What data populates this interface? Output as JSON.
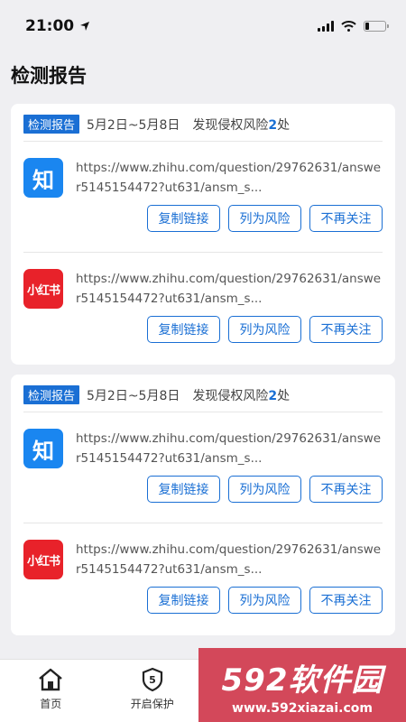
{
  "status_bar": {
    "time": "21:00"
  },
  "page": {
    "title": "检测报告"
  },
  "reports": [
    {
      "tag": "检测报告",
      "date_range": "5月2日~5月8日",
      "risk_prefix": "发现侵权风险",
      "risk_count": "2",
      "risk_suffix": "处",
      "items": [
        {
          "logo": "知",
          "logo_icon": "zhihu-logo-icon",
          "url": "https://www.zhihu.com/question/29762631/answer5145154472?ut631/ansm_s...",
          "btn_copy": "复制链接",
          "btn_risk": "列为风险",
          "btn_ignore": "不再关注"
        },
        {
          "logo": "小红书",
          "logo_icon": "xiaohongshu-logo-icon",
          "url": "https://www.zhihu.com/question/29762631/answer5145154472?ut631/ansm_s...",
          "btn_copy": "复制链接",
          "btn_risk": "列为风险",
          "btn_ignore": "不再关注"
        }
      ]
    },
    {
      "tag": "检测报告",
      "date_range": "5月2日~5月8日",
      "risk_prefix": "发现侵权风险",
      "risk_count": "2",
      "risk_suffix": "处",
      "items": [
        {
          "logo": "知",
          "logo_icon": "zhihu-logo-icon",
          "url": "https://www.zhihu.com/question/29762631/answer5145154472?ut631/ansm_s...",
          "btn_copy": "复制链接",
          "btn_risk": "列为风险",
          "btn_ignore": "不再关注"
        },
        {
          "logo": "小红书",
          "logo_icon": "xiaohongshu-logo-icon",
          "url": "https://www.zhihu.com/question/29762631/answer5145154472?ut631/ansm_s...",
          "btn_copy": "复制链接",
          "btn_risk": "列为风险",
          "btn_ignore": "不再关注"
        }
      ]
    }
  ],
  "tabbar": {
    "home": "首页",
    "protect": "开启保护"
  },
  "watermark": {
    "title": "592软件园",
    "url": "www.592xiazai.com"
  },
  "colors": {
    "accent": "#1a6fd4",
    "zhihu": "#1a86f0",
    "xiaohongshu": "#e8222a",
    "watermark": "#d3485a"
  }
}
